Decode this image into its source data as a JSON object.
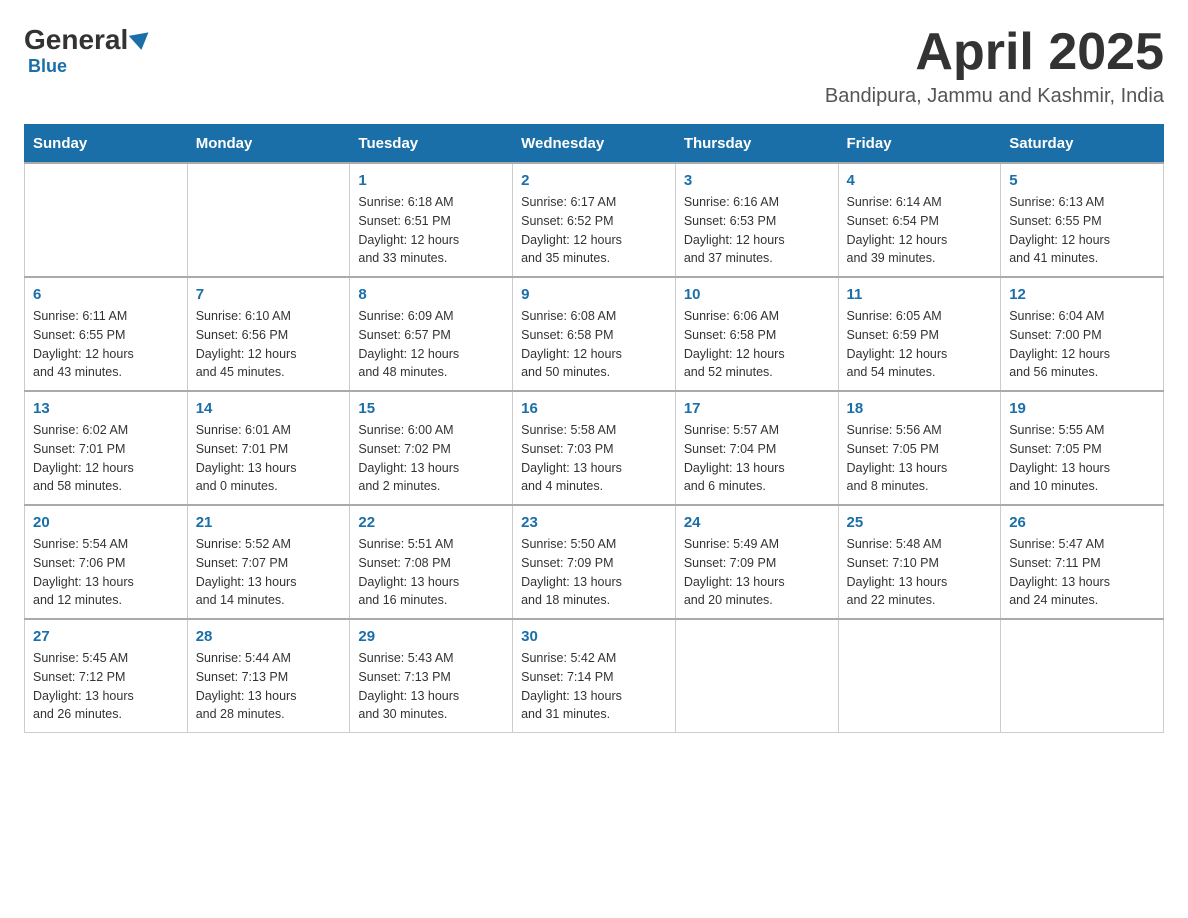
{
  "header": {
    "logo_general": "General",
    "logo_blue": "Blue",
    "month_title": "April 2025",
    "location": "Bandipura, Jammu and Kashmir, India"
  },
  "days_of_week": [
    "Sunday",
    "Monday",
    "Tuesday",
    "Wednesday",
    "Thursday",
    "Friday",
    "Saturday"
  ],
  "weeks": [
    [
      {
        "day": "",
        "info": ""
      },
      {
        "day": "",
        "info": ""
      },
      {
        "day": "1",
        "info": "Sunrise: 6:18 AM\nSunset: 6:51 PM\nDaylight: 12 hours\nand 33 minutes."
      },
      {
        "day": "2",
        "info": "Sunrise: 6:17 AM\nSunset: 6:52 PM\nDaylight: 12 hours\nand 35 minutes."
      },
      {
        "day": "3",
        "info": "Sunrise: 6:16 AM\nSunset: 6:53 PM\nDaylight: 12 hours\nand 37 minutes."
      },
      {
        "day": "4",
        "info": "Sunrise: 6:14 AM\nSunset: 6:54 PM\nDaylight: 12 hours\nand 39 minutes."
      },
      {
        "day": "5",
        "info": "Sunrise: 6:13 AM\nSunset: 6:55 PM\nDaylight: 12 hours\nand 41 minutes."
      }
    ],
    [
      {
        "day": "6",
        "info": "Sunrise: 6:11 AM\nSunset: 6:55 PM\nDaylight: 12 hours\nand 43 minutes."
      },
      {
        "day": "7",
        "info": "Sunrise: 6:10 AM\nSunset: 6:56 PM\nDaylight: 12 hours\nand 45 minutes."
      },
      {
        "day": "8",
        "info": "Sunrise: 6:09 AM\nSunset: 6:57 PM\nDaylight: 12 hours\nand 48 minutes."
      },
      {
        "day": "9",
        "info": "Sunrise: 6:08 AM\nSunset: 6:58 PM\nDaylight: 12 hours\nand 50 minutes."
      },
      {
        "day": "10",
        "info": "Sunrise: 6:06 AM\nSunset: 6:58 PM\nDaylight: 12 hours\nand 52 minutes."
      },
      {
        "day": "11",
        "info": "Sunrise: 6:05 AM\nSunset: 6:59 PM\nDaylight: 12 hours\nand 54 minutes."
      },
      {
        "day": "12",
        "info": "Sunrise: 6:04 AM\nSunset: 7:00 PM\nDaylight: 12 hours\nand 56 minutes."
      }
    ],
    [
      {
        "day": "13",
        "info": "Sunrise: 6:02 AM\nSunset: 7:01 PM\nDaylight: 12 hours\nand 58 minutes."
      },
      {
        "day": "14",
        "info": "Sunrise: 6:01 AM\nSunset: 7:01 PM\nDaylight: 13 hours\nand 0 minutes."
      },
      {
        "day": "15",
        "info": "Sunrise: 6:00 AM\nSunset: 7:02 PM\nDaylight: 13 hours\nand 2 minutes."
      },
      {
        "day": "16",
        "info": "Sunrise: 5:58 AM\nSunset: 7:03 PM\nDaylight: 13 hours\nand 4 minutes."
      },
      {
        "day": "17",
        "info": "Sunrise: 5:57 AM\nSunset: 7:04 PM\nDaylight: 13 hours\nand 6 minutes."
      },
      {
        "day": "18",
        "info": "Sunrise: 5:56 AM\nSunset: 7:05 PM\nDaylight: 13 hours\nand 8 minutes."
      },
      {
        "day": "19",
        "info": "Sunrise: 5:55 AM\nSunset: 7:05 PM\nDaylight: 13 hours\nand 10 minutes."
      }
    ],
    [
      {
        "day": "20",
        "info": "Sunrise: 5:54 AM\nSunset: 7:06 PM\nDaylight: 13 hours\nand 12 minutes."
      },
      {
        "day": "21",
        "info": "Sunrise: 5:52 AM\nSunset: 7:07 PM\nDaylight: 13 hours\nand 14 minutes."
      },
      {
        "day": "22",
        "info": "Sunrise: 5:51 AM\nSunset: 7:08 PM\nDaylight: 13 hours\nand 16 minutes."
      },
      {
        "day": "23",
        "info": "Sunrise: 5:50 AM\nSunset: 7:09 PM\nDaylight: 13 hours\nand 18 minutes."
      },
      {
        "day": "24",
        "info": "Sunrise: 5:49 AM\nSunset: 7:09 PM\nDaylight: 13 hours\nand 20 minutes."
      },
      {
        "day": "25",
        "info": "Sunrise: 5:48 AM\nSunset: 7:10 PM\nDaylight: 13 hours\nand 22 minutes."
      },
      {
        "day": "26",
        "info": "Sunrise: 5:47 AM\nSunset: 7:11 PM\nDaylight: 13 hours\nand 24 minutes."
      }
    ],
    [
      {
        "day": "27",
        "info": "Sunrise: 5:45 AM\nSunset: 7:12 PM\nDaylight: 13 hours\nand 26 minutes."
      },
      {
        "day": "28",
        "info": "Sunrise: 5:44 AM\nSunset: 7:13 PM\nDaylight: 13 hours\nand 28 minutes."
      },
      {
        "day": "29",
        "info": "Sunrise: 5:43 AM\nSunset: 7:13 PM\nDaylight: 13 hours\nand 30 minutes."
      },
      {
        "day": "30",
        "info": "Sunrise: 5:42 AM\nSunset: 7:14 PM\nDaylight: 13 hours\nand 31 minutes."
      },
      {
        "day": "",
        "info": ""
      },
      {
        "day": "",
        "info": ""
      },
      {
        "day": "",
        "info": ""
      }
    ]
  ]
}
